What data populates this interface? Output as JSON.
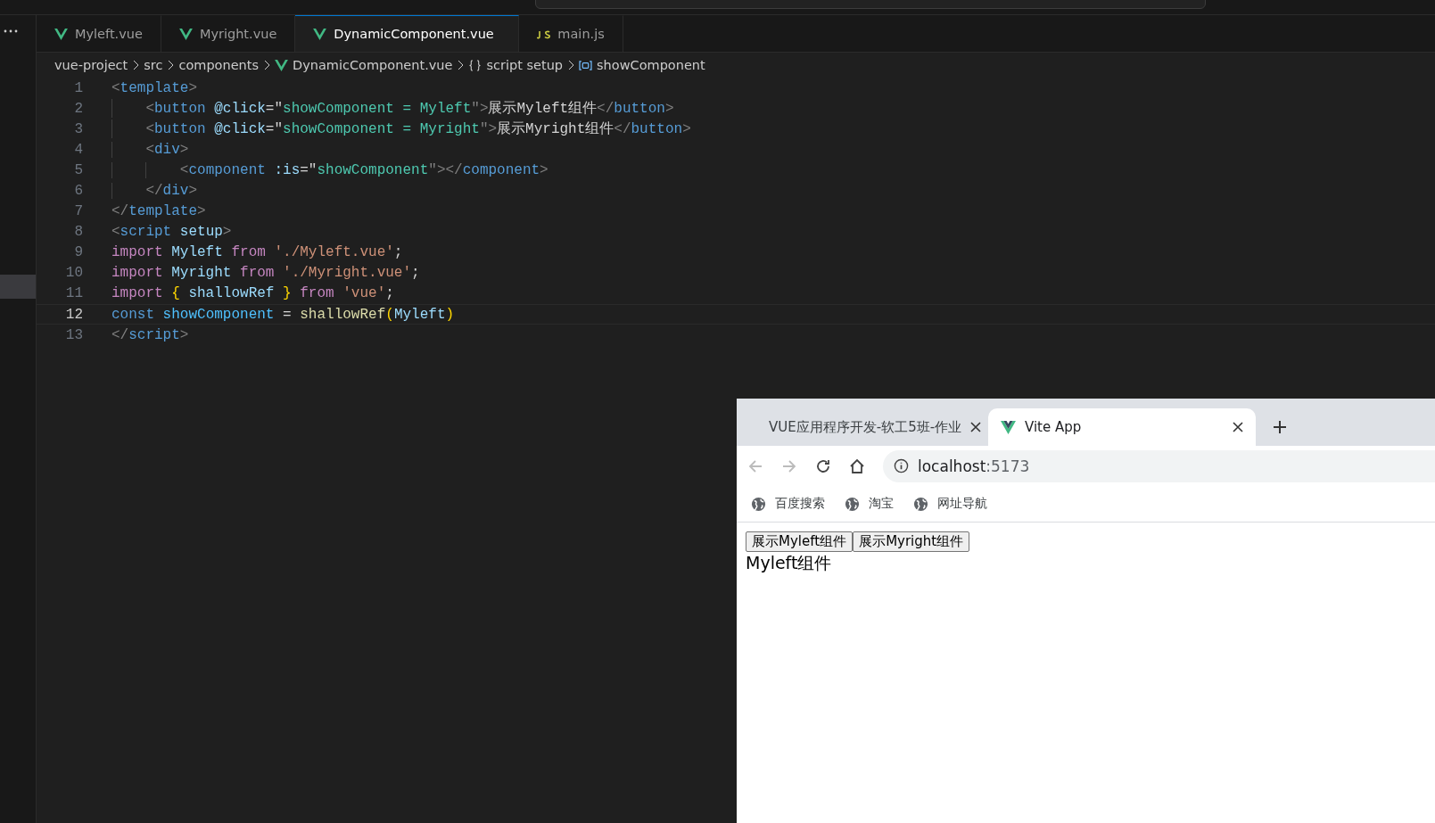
{
  "editor_tabs": [
    {
      "label": "Myleft.vue",
      "kind": "vue",
      "selected": false
    },
    {
      "label": "Myright.vue",
      "kind": "vue",
      "selected": false
    },
    {
      "label": "DynamicComponent.vue",
      "kind": "vue",
      "selected": true
    },
    {
      "label": "main.js",
      "kind": "js",
      "selected": false
    }
  ],
  "breadcrumbs": [
    {
      "label": "vue-project",
      "kind": "folder"
    },
    {
      "label": "src",
      "kind": "folder"
    },
    {
      "label": "components",
      "kind": "folder"
    },
    {
      "label": "DynamicComponent.vue",
      "kind": "vue"
    },
    {
      "label": "script setup",
      "kind": "scope"
    },
    {
      "label": "showComponent",
      "kind": "symbol"
    }
  ],
  "editor": {
    "lines": [
      {
        "number": "1",
        "current": false,
        "tokens": [
          {
            "t": "<",
            "kind": "punct"
          },
          {
            "t": "template",
            "kind": "tag"
          },
          {
            "t": ">",
            "kind": "punct"
          }
        ]
      },
      {
        "number": "2",
        "current": false,
        "tokens": [
          {
            "t": "    <",
            "kind": "punct"
          },
          {
            "t": "button",
            "kind": "tag"
          },
          {
            "t": " @click",
            "kind": "attr"
          },
          {
            "t": "=\"",
            "kind": "text"
          },
          {
            "t": "showComponent = Myleft",
            "kind": "expr"
          },
          {
            "t": "\">",
            "kind": "punct"
          },
          {
            "t": "展示Myleft组件",
            "kind": "text"
          },
          {
            "t": "</",
            "kind": "punct"
          },
          {
            "t": "button",
            "kind": "tag"
          },
          {
            "t": ">",
            "kind": "punct"
          }
        ]
      },
      {
        "number": "3",
        "current": false,
        "tokens": [
          {
            "t": "    <",
            "kind": "punct"
          },
          {
            "t": "button",
            "kind": "tag"
          },
          {
            "t": " @click",
            "kind": "attr"
          },
          {
            "t": "=\"",
            "kind": "text"
          },
          {
            "t": "showComponent = Myright",
            "kind": "expr"
          },
          {
            "t": "\">",
            "kind": "punct"
          },
          {
            "t": "展示Myright组件",
            "kind": "text"
          },
          {
            "t": "</",
            "kind": "punct"
          },
          {
            "t": "button",
            "kind": "tag"
          },
          {
            "t": ">",
            "kind": "punct"
          }
        ]
      },
      {
        "number": "4",
        "current": false,
        "tokens": [
          {
            "t": "    <",
            "kind": "punct"
          },
          {
            "t": "div",
            "kind": "tag"
          },
          {
            "t": ">",
            "kind": "punct"
          }
        ]
      },
      {
        "number": "5",
        "current": false,
        "tokens": [
          {
            "t": "        <",
            "kind": "punct"
          },
          {
            "t": "component",
            "kind": "tag"
          },
          {
            "t": " :is",
            "kind": "attr"
          },
          {
            "t": "=\"",
            "kind": "text"
          },
          {
            "t": "showComponent",
            "kind": "expr"
          },
          {
            "t": "\"></",
            "kind": "punct"
          },
          {
            "t": "component",
            "kind": "tag"
          },
          {
            "t": ">",
            "kind": "punct"
          }
        ]
      },
      {
        "number": "6",
        "current": false,
        "tokens": [
          {
            "t": "    </",
            "kind": "punct"
          },
          {
            "t": "div",
            "kind": "tag"
          },
          {
            "t": ">",
            "kind": "punct"
          }
        ]
      },
      {
        "number": "7",
        "current": false,
        "tokens": [
          {
            "t": "</",
            "kind": "punct"
          },
          {
            "t": "template",
            "kind": "tag"
          },
          {
            "t": ">",
            "kind": "punct"
          }
        ]
      },
      {
        "number": "8",
        "current": false,
        "tokens": [
          {
            "t": "<",
            "kind": "punct"
          },
          {
            "t": "script",
            "kind": "tag"
          },
          {
            "t": " setup",
            "kind": "attr"
          },
          {
            "t": ">",
            "kind": "punct"
          }
        ]
      },
      {
        "number": "9",
        "current": false,
        "tokens": [
          {
            "t": "import",
            "kind": "keyword"
          },
          {
            "t": " Myleft ",
            "kind": "var"
          },
          {
            "t": "from",
            "kind": "keyword"
          },
          {
            "t": " './Myleft.vue'",
            "kind": "string"
          },
          {
            "t": ";",
            "kind": "text"
          }
        ]
      },
      {
        "number": "10",
        "current": false,
        "tokens": [
          {
            "t": "import",
            "kind": "keyword"
          },
          {
            "t": " Myright ",
            "kind": "var"
          },
          {
            "t": "from",
            "kind": "keyword"
          },
          {
            "t": " './Myright.vue'",
            "kind": "string"
          },
          {
            "t": ";",
            "kind": "text"
          }
        ]
      },
      {
        "number": "11",
        "current": false,
        "tokens": [
          {
            "t": "import",
            "kind": "keyword"
          },
          {
            "t": " {",
            "kind": "brace"
          },
          {
            "t": " shallowRef ",
            "kind": "var"
          },
          {
            "t": "}",
            "kind": "brace"
          },
          {
            "t": " from",
            "kind": "keyword"
          },
          {
            "t": " 'vue'",
            "kind": "string"
          },
          {
            "t": ";",
            "kind": "text"
          }
        ]
      },
      {
        "number": "12",
        "current": true,
        "tokens": [
          {
            "t": "const",
            "kind": "storage"
          },
          {
            "t": " showComponent",
            "kind": "constvar"
          },
          {
            "t": " = ",
            "kind": "text"
          },
          {
            "t": "shallowRef",
            "kind": "func"
          },
          {
            "t": "(",
            "kind": "brace"
          },
          {
            "t": "Myleft",
            "kind": "var"
          },
          {
            "t": ")",
            "kind": "brace"
          }
        ]
      },
      {
        "number": "13",
        "current": false,
        "tokens": [
          {
            "t": "</",
            "kind": "punct"
          },
          {
            "t": "script",
            "kind": "tag"
          },
          {
            "t": ">",
            "kind": "punct"
          }
        ]
      }
    ]
  },
  "browser": {
    "tabs": [
      {
        "title": "VUE应用程序开发-软工5班-作业",
        "kind": "site",
        "selected": false
      },
      {
        "title": "Vite App",
        "kind": "vite",
        "selected": true
      }
    ],
    "address": {
      "host": "localhost",
      "port": ":5173"
    },
    "bookmarks": [
      {
        "label": "百度搜索"
      },
      {
        "label": "淘宝"
      },
      {
        "label": "网址导航"
      }
    ],
    "page": {
      "buttons": [
        "展示Myleft组件",
        "展示Myright组件"
      ],
      "text": "Myleft组件"
    }
  }
}
